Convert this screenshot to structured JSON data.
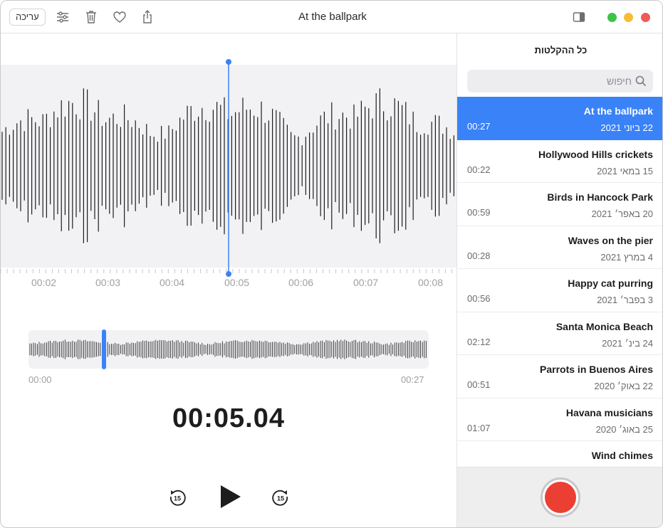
{
  "toolbar": {
    "edit_label": "עריכה",
    "title": "At the ballpark",
    "icons": [
      "sliders-icon",
      "trash-icon",
      "heart-icon",
      "share-icon",
      "sidebar-toggle-icon"
    ],
    "traffic_colors": {
      "green": "#3ec449",
      "yellow": "#f5be35",
      "red": "#ee5b57"
    }
  },
  "sidebar": {
    "title": "כל ההקלטות",
    "search_placeholder": "חיפוש",
    "recordings": [
      {
        "title": "At the ballpark",
        "date": "22 ביוני 2021",
        "duration": "00:27",
        "selected": true
      },
      {
        "title": "Hollywood Hills crickets",
        "date": "15 במאי 2021",
        "duration": "00:22"
      },
      {
        "title": "Birds in Hancock Park",
        "date": "20 באפר׳ 2021",
        "duration": "00:59"
      },
      {
        "title": "Waves on the pier",
        "date": "4 במרץ 2021",
        "duration": "00:28"
      },
      {
        "title": "Happy cat purring",
        "date": "3 בפבר׳ 2021",
        "duration": "00:56"
      },
      {
        "title": "Santa Monica Beach",
        "date": "24 בינ׳ 2021",
        "duration": "02:12"
      },
      {
        "title": "Parrots in Buenos Aires",
        "date": "22 באוק׳ 2020",
        "duration": "00:51"
      },
      {
        "title": "Havana musicians",
        "date": "25 באוג׳ 2020",
        "duration": "01:07"
      },
      {
        "title": "Wind chimes",
        "date": "",
        "duration": ""
      }
    ],
    "record_color": "#ec3f33"
  },
  "player": {
    "ruler_labels": [
      "00:02",
      "00:03",
      "00:04",
      "00:05",
      "00:06",
      "00:07",
      "00:08"
    ],
    "overview_start": "00:00",
    "overview_end": "00:27",
    "current_time": "00:05.04",
    "skip_back_label": "15",
    "skip_forward_label": "15",
    "playhead_color": "#3a82f7"
  }
}
